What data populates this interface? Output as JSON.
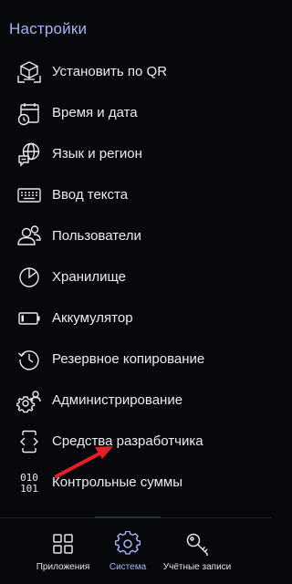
{
  "header": {
    "title": "Настройки"
  },
  "menu": [
    {
      "label": "Установить по QR",
      "icon": "qr-install-icon"
    },
    {
      "label": "Время и дата",
      "icon": "calendar-clock-icon"
    },
    {
      "label": "Язык и регион",
      "icon": "globe-chat-icon"
    },
    {
      "label": "Ввод текста",
      "icon": "keyboard-icon"
    },
    {
      "label": "Пользователи",
      "icon": "users-icon"
    },
    {
      "label": "Хранилище",
      "icon": "pie-chart-icon"
    },
    {
      "label": "Аккумулятор",
      "icon": "battery-icon"
    },
    {
      "label": "Резервное копирование",
      "icon": "backup-history-icon"
    },
    {
      "label": "Администрирование",
      "icon": "admin-gear-icon"
    },
    {
      "label": "Средства разработчика",
      "icon": "developer-phone-icon"
    },
    {
      "label": "Контрольные суммы",
      "icon": "binary-checksum-icon",
      "icon_text": [
        "010",
        "101"
      ]
    }
  ],
  "bottom_nav": [
    {
      "label": "Приложения",
      "icon": "apps-grid-icon",
      "active": false
    },
    {
      "label": "Система",
      "icon": "system-gear-icon",
      "active": true
    },
    {
      "label": "Учётные записи",
      "icon": "key-icon",
      "active": false
    }
  ],
  "colors": {
    "background": "#07080c",
    "accent": "#a9b3f5",
    "text": "#ececf0",
    "annotation_arrow": "#e0202a"
  }
}
